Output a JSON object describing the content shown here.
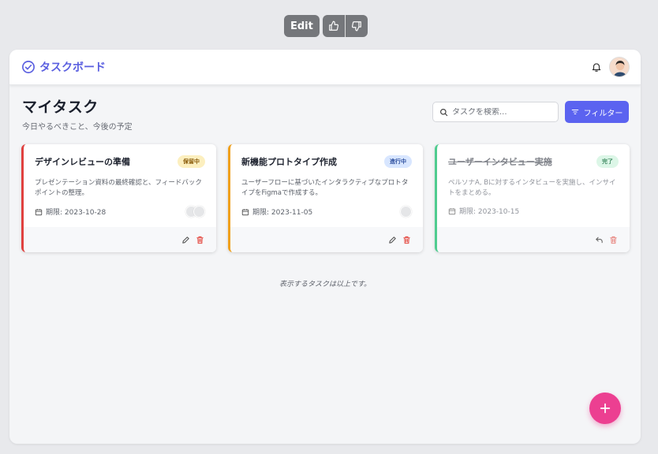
{
  "toolbar": {
    "edit_label": "Edit"
  },
  "app": {
    "brand": "タスクボード",
    "accent": "#5b63f0"
  },
  "page": {
    "title": "マイタスク",
    "subtitle": "今日やるべきこと、今後の予定"
  },
  "search": {
    "placeholder": "タスクを検索..."
  },
  "filter": {
    "label": "フィルター"
  },
  "tasks": [
    {
      "title": "デザインレビューの準備",
      "status": "保留中",
      "desc": "プレゼンテーション資料の最終確認と、フィードバックポイントの整理。",
      "due": "期限: 2023-10-28",
      "color": "#e0413f",
      "assignee_count": 2
    },
    {
      "title": "新機能プロトタイプ作成",
      "status": "進行中",
      "desc": "ユーザーフローに基づいたインタラクティブなプロトタイプをFigmaで作成する。",
      "due": "期限: 2023-11-05",
      "color": "#f0a01c",
      "assignee_count": 1
    },
    {
      "title": "ユーザーインタビュー実施",
      "status": "完了",
      "desc": "ペルソナA, Bに対するインタビューを実施し、インサイトをまとめる。",
      "due": "期限: 2023-10-15",
      "color": "#4fcc8f",
      "assignee_count": 0
    }
  ],
  "end_note": "表示するタスクは以上です。",
  "icons": {
    "brand": "check-circle-icon",
    "notifications": "bell-icon",
    "search": "search-icon",
    "filter": "filter-icon",
    "calendar": "calendar-icon",
    "edit": "pencil-icon",
    "delete": "trash-icon",
    "undo": "undo-icon",
    "add": "plus-icon"
  }
}
